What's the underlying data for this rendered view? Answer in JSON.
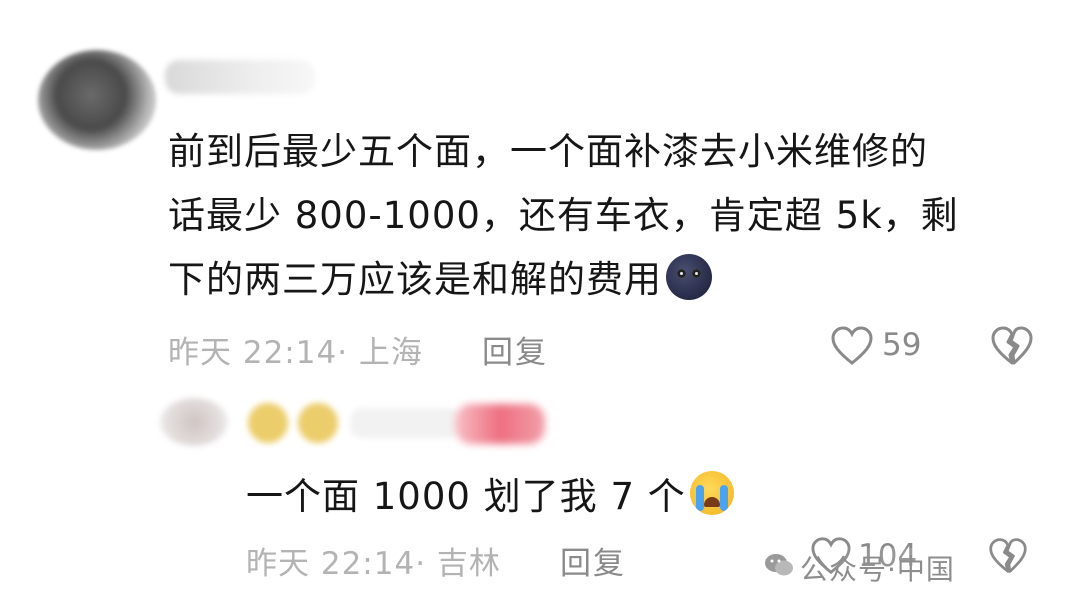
{
  "comment1": {
    "line1": "前到后最少五个面，一个面补漆去小米维修的",
    "line2": "话最少 800-1000，还有车衣，肯定超 5k，剩",
    "line3": "下的两三万应该是和解的费用",
    "emoji": "moon-face-emoji",
    "time_location": "昨天 22:14· 上海",
    "reply_label": "回复",
    "like_count": "59"
  },
  "comment2": {
    "text": "一个面 1000 划了我 7 个",
    "emoji": "loudly-crying-emoji",
    "time_location": "昨天 22:14· 吉林",
    "reply_label": "回复",
    "like_count": "104"
  },
  "watermark": {
    "text": "公众号·中国"
  },
  "colors": {
    "text": "#161616",
    "meta": "#b3b3b3",
    "action": "#8a8a8a"
  }
}
